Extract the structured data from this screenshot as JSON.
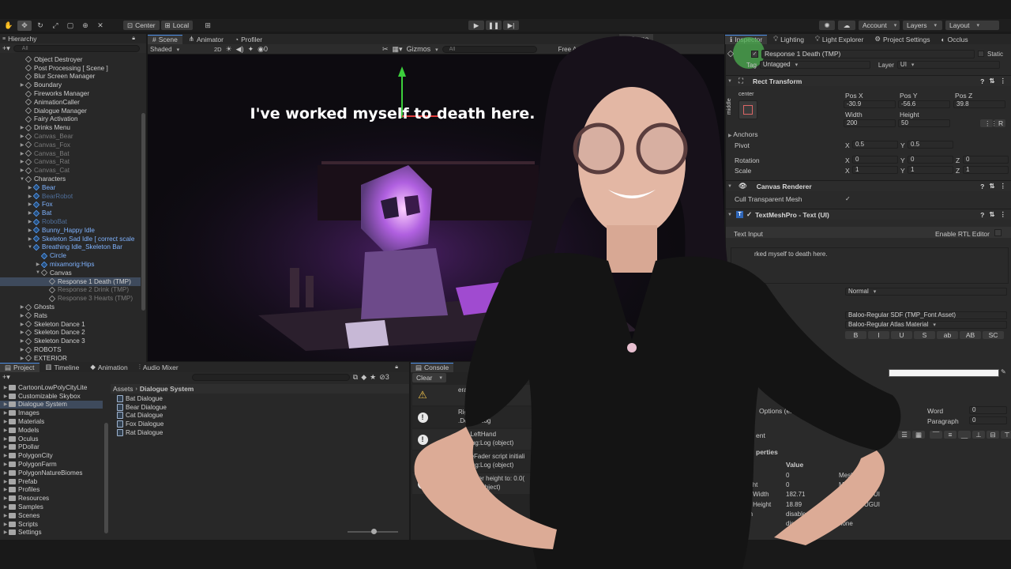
{
  "toolbar": {
    "pivot": "Center",
    "space": "Local",
    "account": "Account",
    "layers": "Layers",
    "layout": "Layout"
  },
  "hierarchy": {
    "title": "Hierarchy",
    "search_placeholder": "All",
    "items": [
      {
        "label": "Object Destroyer",
        "indent": 0,
        "arrow": "",
        "type": "obj",
        "style": ""
      },
      {
        "label": "Post Processing [ Scene ]",
        "indent": 0,
        "arrow": "",
        "type": "obj",
        "style": ""
      },
      {
        "label": "Blur Screen Manager",
        "indent": 0,
        "arrow": "",
        "type": "obj",
        "style": ""
      },
      {
        "label": "Boundary",
        "indent": 0,
        "arrow": "▶",
        "type": "obj",
        "style": ""
      },
      {
        "label": "Fireworks Manager",
        "indent": 0,
        "arrow": "",
        "type": "obj",
        "style": ""
      },
      {
        "label": "AnimationCaller",
        "indent": 0,
        "arrow": "",
        "type": "obj",
        "style": ""
      },
      {
        "label": "Dialogue Manager",
        "indent": 0,
        "arrow": "",
        "type": "obj",
        "style": ""
      },
      {
        "label": "Fairy Activation",
        "indent": 0,
        "arrow": "",
        "type": "obj",
        "style": ""
      },
      {
        "label": "Drinks Menu",
        "indent": 0,
        "arrow": "▶",
        "type": "obj",
        "style": ""
      },
      {
        "label": "Canvas_Bear",
        "indent": 0,
        "arrow": "▶",
        "type": "obj",
        "style": "dim"
      },
      {
        "label": "Canvas_Fox",
        "indent": 0,
        "arrow": "▶",
        "type": "obj",
        "style": "dim"
      },
      {
        "label": "Canvas_Bat",
        "indent": 0,
        "arrow": "▶",
        "type": "obj",
        "style": "dim"
      },
      {
        "label": "Canvas_Rat",
        "indent": 0,
        "arrow": "▶",
        "type": "obj",
        "style": "dim"
      },
      {
        "label": "Canvas_Cat",
        "indent": 0,
        "arrow": "▶",
        "type": "obj",
        "style": "dim"
      },
      {
        "label": "Characters",
        "indent": 0,
        "arrow": "▼",
        "type": "obj",
        "style": ""
      },
      {
        "label": "Bear",
        "indent": 1,
        "arrow": "▶",
        "type": "prefab",
        "style": "pf"
      },
      {
        "label": "BearRobot",
        "indent": 1,
        "arrow": "▶",
        "type": "prefab",
        "style": "pfdim"
      },
      {
        "label": "Fox",
        "indent": 1,
        "arrow": "▶",
        "type": "prefab",
        "style": "pf"
      },
      {
        "label": "Bat",
        "indent": 1,
        "arrow": "▶",
        "type": "prefab",
        "style": "pf"
      },
      {
        "label": "RoboBat",
        "indent": 1,
        "arrow": "▶",
        "type": "prefab",
        "style": "pfdim"
      },
      {
        "label": "Bunny_Happy Idle",
        "indent": 1,
        "arrow": "▶",
        "type": "prefab",
        "style": "pf"
      },
      {
        "label": "Skeleton Sad Idle [ correct scale",
        "indent": 1,
        "arrow": "▶",
        "type": "prefab",
        "style": "pf"
      },
      {
        "label": "Breathing Idle_Skeleton Bar",
        "indent": 1,
        "arrow": "▼",
        "type": "prefab",
        "style": "pf"
      },
      {
        "label": "Circle",
        "indent": 2,
        "arrow": "",
        "type": "prefab",
        "style": "pf"
      },
      {
        "label": "mixamorig:Hips",
        "indent": 2,
        "arrow": "▶",
        "type": "prefab",
        "style": "pf"
      },
      {
        "label": "Canvas",
        "indent": 2,
        "arrow": "▼",
        "type": "obj",
        "style": ""
      },
      {
        "label": "Response 1 Death (TMP)",
        "indent": 3,
        "arrow": "",
        "type": "obj",
        "style": "sel"
      },
      {
        "label": "Response 2 Drink (TMP)",
        "indent": 3,
        "arrow": "",
        "type": "obj",
        "style": "dim"
      },
      {
        "label": "Response 3 Hearts (TMP)",
        "indent": 3,
        "arrow": "",
        "type": "obj",
        "style": "dim"
      },
      {
        "label": "Ghosts",
        "indent": 0,
        "arrow": "▶",
        "type": "obj",
        "style": ""
      },
      {
        "label": "Rats",
        "indent": 0,
        "arrow": "▶",
        "type": "obj",
        "style": ""
      },
      {
        "label": "Skeleton Dance 1",
        "indent": 0,
        "arrow": "▶",
        "type": "obj",
        "style": ""
      },
      {
        "label": "Skeleton Dance 2",
        "indent": 0,
        "arrow": "▶",
        "type": "obj",
        "style": ""
      },
      {
        "label": "Skeleton Dance 3",
        "indent": 0,
        "arrow": "▶",
        "type": "obj",
        "style": ""
      },
      {
        "label": "ROBOTS",
        "indent": 0,
        "arrow": "▶",
        "type": "obj",
        "style": ""
      },
      {
        "label": "EXTERIOR",
        "indent": 0,
        "arrow": "▶",
        "type": "obj",
        "style": ""
      }
    ]
  },
  "scene": {
    "tabs": [
      "Scene",
      "Animator",
      "Profiler",
      "Game"
    ],
    "shading": "Shaded",
    "mode_2d": "2D",
    "gizmos": "Gizmos",
    "search_placeholder": "All",
    "game_aspect": "Free Aspect",
    "caption": "I've worked myself to death here."
  },
  "inspector": {
    "tabs": [
      "Inspector",
      "Lighting",
      "Light Explorer",
      "Project Settings",
      "Occlus"
    ],
    "object_name": "Response 1 Death (TMP)",
    "static_label": "Static",
    "tag_label": "Tag",
    "tag_value": "Untagged",
    "layer_label": "Layer",
    "layer_value": "UI",
    "rect": {
      "title": "Rect Transform",
      "anchor_h": "center",
      "anchor_v": "middle",
      "posx_label": "Pos X",
      "posy_label": "Pos Y",
      "posz_label": "Pos Z",
      "posx": "-30.9",
      "posy": "-56.6",
      "posz": "39.8",
      "width_label": "Width",
      "height_label": "Height",
      "width": "200",
      "height": "50",
      "anchors": "Anchors",
      "pivot": "Pivot",
      "pivot_x": "0.5",
      "pivot_y": "0.5",
      "rotation": "Rotation",
      "rot_x": "0",
      "rot_y": "0",
      "rot_z": "0",
      "scale": "Scale",
      "scale_x": "1",
      "scale_y": "1",
      "scale_z": "1",
      "x": "X",
      "y": "Y",
      "z": "Z",
      "r": "R"
    },
    "canvas_renderer": {
      "title": "Canvas Renderer",
      "cull": "Cull Transparent Mesh"
    },
    "tmp": {
      "title": "TextMeshPro - Text (UI)",
      "text_input": "Text Input",
      "rtl": "Enable RTL Editor",
      "text_value": "rked myself to death here.",
      "style_value": "Normal",
      "font_asset": "Baloo-Regular SDF (TMP_Font Asset)",
      "material": "Baloo-Regular Atlas Material",
      "style_buttons": [
        "B",
        "I",
        "U",
        "S",
        "ab",
        "AB",
        "SC"
      ],
      "options": "Options (em)",
      "char": "Char",
      "line": "Line",
      "word": "Word",
      "paragraph": "Paragraph",
      "word_val": "0",
      "paragraph_val": "0",
      "alignment": "ent",
      "properties": "perties"
    },
    "props": {
      "col_header": "Value",
      "rows": [
        {
          "name": "th",
          "value": "0",
          "src": "MeshProUGUI"
        },
        {
          "name": "eight",
          "value": "0",
          "src": "MeshProUGUI"
        },
        {
          "name": "ed Width",
          "value": "182.71",
          "src": "MeshProUGUI"
        },
        {
          "name": "ed Height",
          "value": "18.89",
          "src": "MeshProUGUI"
        },
        {
          "name": "dth",
          "value": "disabled",
          "src": "none"
        },
        {
          "name": "",
          "value": "disabled",
          "src": "none"
        }
      ]
    }
  },
  "project": {
    "tabs": [
      "Project",
      "Timeline",
      "Animation",
      "Audio Mixer"
    ],
    "folders": [
      "CartoonLowPolyCityLite",
      "Customizable Skybox",
      "Dialogue System",
      "Images",
      "Materials",
      "Models",
      "Oculus",
      "PDollar",
      "PolygonCity",
      "PolygonFarm",
      "PolygonNatureBiomes",
      "Prefab",
      "Profiles",
      "Resources",
      "Samples",
      "Scenes",
      "Scripts",
      "Settings"
    ],
    "selected_folder": "Dialogue System",
    "breadcrumb_root": "Assets",
    "breadcrumb_current": "Dialogue System",
    "files": [
      "Bat Dialogue",
      "Bear Dialogue",
      "Cat Dialogue",
      "Fox Dialogue",
      "Rat Dialogue"
    ],
    "hidden_count": "3"
  },
  "console": {
    "tab": "Console",
    "clear": "Clear",
    "entries": [
      {
        "line1": "erat",
        "line2": ""
      },
      {
        "line1": "Right",
        "line2": ".Debug:Log"
      },
      {
        "line1": "XRI LeftHand",
        "line2": ".Debug:Log (object)"
      },
      {
        "line1": "osureFader script initiali",
        "line2": ".Debug:Log (object)"
      },
      {
        "line1": "ed player height to: 0.0(",
        "line2": "ne:Log (object)"
      }
    ]
  },
  "colors": {
    "accent": "#4b8de6",
    "prefab_blue": "#7fb3ff",
    "panel": "#282828",
    "bg": "#191919",
    "highlight": "#4caf50"
  }
}
